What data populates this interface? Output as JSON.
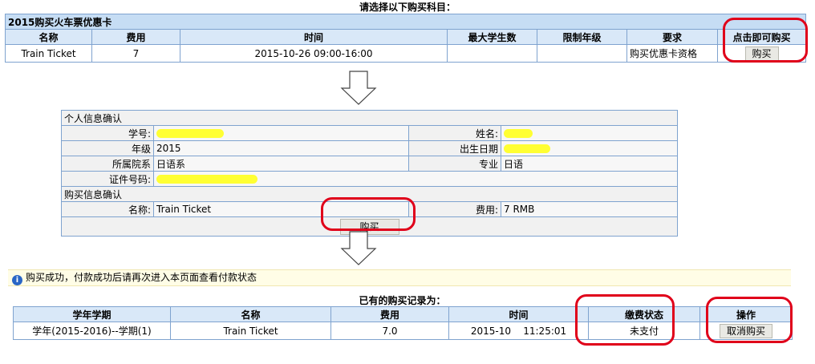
{
  "section1": {
    "heading": "请选择以下购买科目：",
    "table_title": "2015购买火车票优惠卡",
    "columns": [
      "名称",
      "费用",
      "时间",
      "最大学生数",
      "限制年级",
      "要求",
      "点击即可购买"
    ],
    "row": {
      "name": "Train Ticket",
      "fee": "7",
      "time": "2015-10-26 09:00-16:00",
      "max_students": "",
      "grade_limit": "",
      "requirement": "购买优惠卡资格"
    },
    "buy_label": "购买"
  },
  "section2": {
    "personal_heading": "个人信息确认",
    "student_id_label": "学号:",
    "name_label": "姓名:",
    "grade_label": "年级",
    "grade_value": "2015",
    "birth_label": "出生日期",
    "dept_label": "所属院系",
    "dept_value": "日语系",
    "major_label": "专业",
    "major_value": "日语",
    "id_label": "证件号码:",
    "purchase_heading": "购买信息确认",
    "item_label": "名称:",
    "item_value": "Train Ticket",
    "fee_label": "费用:",
    "fee_value": "7 RMB",
    "buy_label": "购买"
  },
  "section3": {
    "notice": "购买成功，付款成功后请再次进入本页面查看付款状态",
    "records_title": "已有的购买记录为：",
    "columns": [
      "学年学期",
      "名称",
      "费用",
      "时间",
      "缴费状态",
      "操作"
    ],
    "row": {
      "term": "学年(2015-2016)--学期(1)",
      "name": "Train Ticket",
      "fee": "7.0",
      "time": "2015-10    11:25:01",
      "status": "未支付"
    },
    "cancel_label": "取消购买"
  },
  "colors": {
    "accent_red": "#e0001a",
    "highlight": "#ffff33",
    "border_blue": "#7fa3cf",
    "header_blue": "#d9e8f8"
  }
}
